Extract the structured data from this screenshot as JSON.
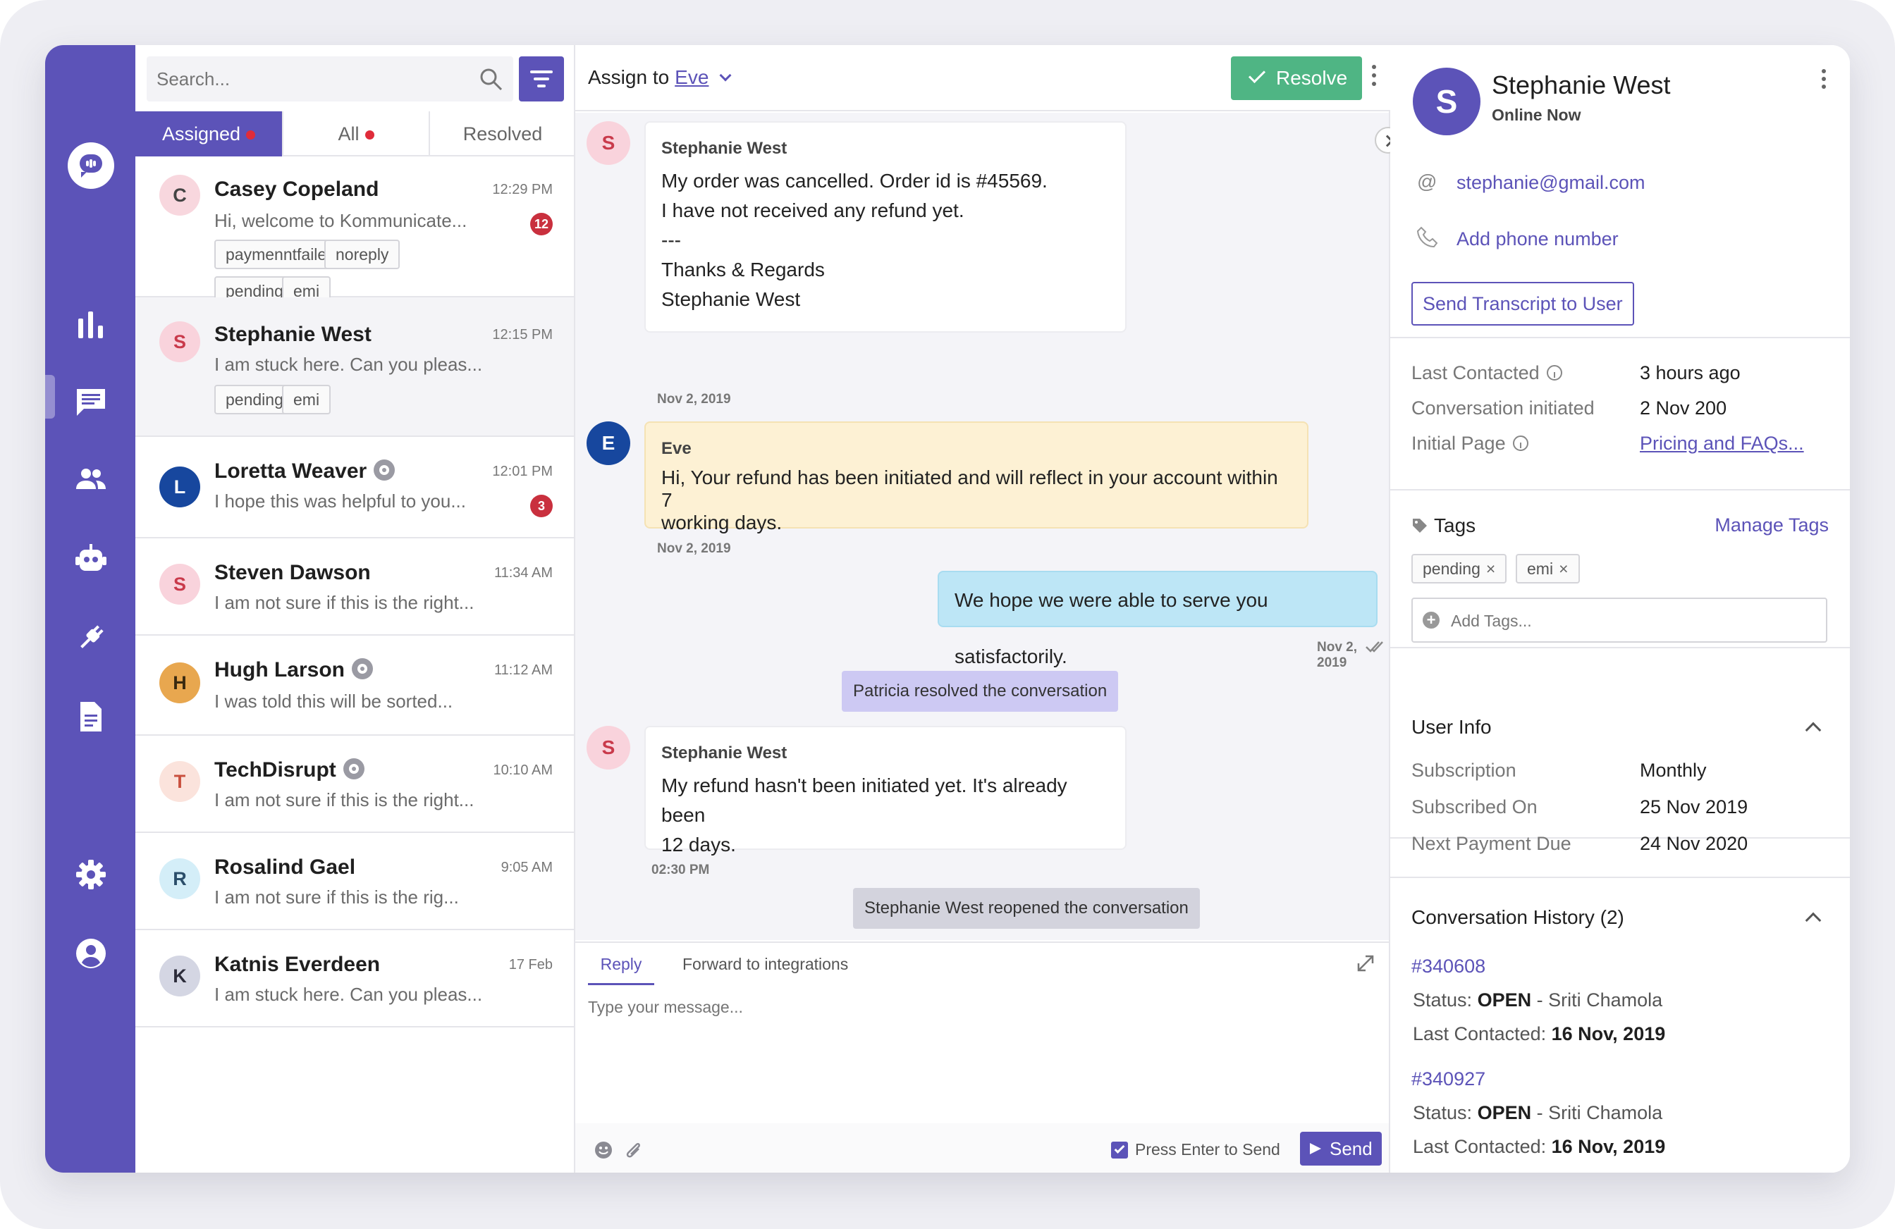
{
  "search": {
    "placeholder": "Search..."
  },
  "tabs": [
    {
      "label": "Assigned"
    },
    {
      "label": "All"
    },
    {
      "label": "Resolved"
    }
  ],
  "conversations": [
    {
      "initial": "C",
      "name": "Casey Copeland",
      "time": "12:29 PM",
      "preview": "Hi, welcome to Kommunicate...",
      "badge": "12",
      "tags": [
        "paymenntfailed",
        "noreply",
        "pending",
        "emi"
      ],
      "avatar_bg": "#f8d7de",
      "avatar_fg": "#444444"
    },
    {
      "initial": "S",
      "name": "Stephanie West",
      "time": "12:15 PM",
      "preview": "I am stuck here. Can you pleas...",
      "tags": [
        "pending",
        "emi"
      ],
      "avatar_bg": "#f9d3dc",
      "avatar_fg": "#c93a4b"
    },
    {
      "initial": "L",
      "name": "Loretta Weaver",
      "time": "12:01 PM",
      "preview": "I hope this was helpful to you...",
      "badge": "3",
      "avatar_bg": "#17479e",
      "avatar_fg": "#ffffff"
    },
    {
      "initial": "S",
      "name": "Steven Dawson",
      "time": "11:34 AM",
      "preview": "I am not sure if this is the right...",
      "avatar_bg": "#f9d3dc",
      "avatar_fg": "#c93a4b"
    },
    {
      "initial": "H",
      "name": "Hugh Larson",
      "time": "11:12 AM",
      "preview": "I was told this will be sorted...",
      "avatar_bg": "#e8a74f",
      "avatar_fg": "#3a2a10"
    },
    {
      "initial": "T",
      "name": "TechDisrupt",
      "time": "10:10 AM",
      "preview": "I am not sure if this is the right...",
      "avatar_bg": "#fbe3dc",
      "avatar_fg": "#c9503e"
    },
    {
      "initial": "R",
      "name": "Rosalind Gael",
      "time": "9:05 AM",
      "preview": "I am not sure if this is the rig...",
      "avatar_bg": "#d4eef8",
      "avatar_fg": "#2b4e6a"
    },
    {
      "initial": "K",
      "name": "Katnis Everdeen",
      "time": "17 Feb",
      "preview": "I am stuck here. Can you pleas...",
      "avatar_bg": "#d4d6e3",
      "avatar_fg": "#2c2c3a"
    }
  ],
  "chat_header": {
    "assign_label": "Assign to",
    "assignee": "Eve",
    "resolve_label": "Resolve"
  },
  "messages": [
    {
      "from": "Stephanie West",
      "initial": "S",
      "lines": [
        "My order was cancelled. Order id is #45569.",
        "I have not received any refund yet.",
        "---",
        "Thanks & Regards",
        "Stephanie West"
      ],
      "date": "Nov 2, 2019"
    },
    {
      "from": "Eve",
      "initial": "E",
      "lines": [
        "Hi, Your refund has been initiated and will reflect in your account within 7",
        "working days."
      ],
      "date": "Nov 2, 2019"
    },
    {
      "lines": [
        "We hope we were able to serve you satisfactorily."
      ],
      "date": "Nov 2, 2019"
    },
    {
      "from": "Stephanie West",
      "initial": "S",
      "lines": [
        "My refund hasn't been initiated yet. It's already been",
        "12 days."
      ],
      "date": "02:30 PM"
    }
  ],
  "system_events": [
    "Patricia resolved the conversation",
    "Stephanie West reopened the conversation"
  ],
  "reply": {
    "tab_reply": "Reply",
    "tab_forward": "Forward to integrations",
    "placeholder": "Type your message...",
    "enter_label": "Press Enter to Send",
    "send_label": "Send"
  },
  "user": {
    "initial": "S",
    "name": "Stephanie West",
    "status": "Online Now",
    "email": "stephanie@gmail.com",
    "phone_label": "Add phone number",
    "transcript_label": "Send Transcript to User"
  },
  "details": [
    {
      "label": "Last Contacted",
      "value": "3 hours ago"
    },
    {
      "label": "Conversation initiated",
      "value": "2 Nov 200"
    },
    {
      "label": "Initial Page",
      "value": "Pricing and FAQs..."
    }
  ],
  "tags_section": {
    "title": "Tags",
    "manage_label": "Manage Tags",
    "tags": [
      "pending",
      "emi"
    ],
    "add_placeholder": "Add Tags..."
  },
  "user_info": {
    "title": "User Info",
    "rows": [
      {
        "label": "Subscription",
        "value": "Monthly"
      },
      {
        "label": "Subscribed On",
        "value": "25 Nov 2019"
      },
      {
        "label": "Next Payment Due",
        "value": "24 Nov 2020"
      }
    ]
  },
  "history": {
    "title": "Conversation History (2)",
    "items": [
      {
        "id": "#340608",
        "status_label": "Status:",
        "status": "OPEN",
        "agent": "- Sriti Chamola",
        "last_label": "Last Contacted:",
        "last": "16 Nov, 2019"
      },
      {
        "id": "#340927",
        "status_label": "Status:",
        "status": "OPEN",
        "agent": "- Sriti Chamola",
        "last_label": "Last Contacted:",
        "last": "16 Nov, 2019"
      }
    ]
  },
  "colors": {
    "brand": "#5c53b8",
    "resolve": "#4fb584",
    "badge": "#c9303e",
    "agent_bubble": "#fdf1d4",
    "outgoing_bubble": "#bde6f6",
    "system_resolved": "#cdc9f3",
    "system_reopened": "#d3d3dd"
  }
}
